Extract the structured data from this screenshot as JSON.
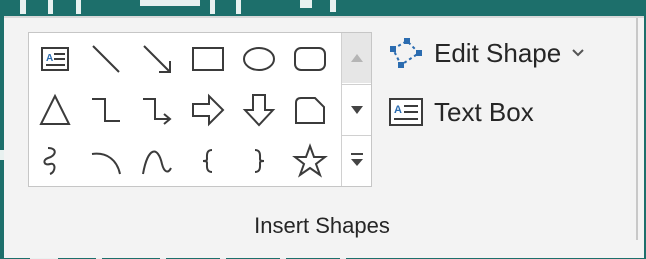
{
  "ribbon": {
    "group_label": "Insert Shapes",
    "commands": [
      {
        "label": "Edit Shape",
        "icon": "edit-shape-icon",
        "has_dropdown": true
      },
      {
        "label": "Text Box",
        "icon": "text-box-icon",
        "has_dropdown": false
      }
    ],
    "gallery": {
      "shapes": [
        [
          "text-box-shape-icon",
          "line-icon",
          "arrow-line-icon",
          "rectangle-icon",
          "oval-icon",
          "rounded-rectangle-icon"
        ],
        [
          "triangle-icon",
          "elbow-connector-icon",
          "elbow-arrow-connector-icon",
          "right-arrow-icon",
          "down-arrow-icon",
          "snip-corner-rectangle-icon"
        ],
        [
          "freeform-scribble-icon",
          "arc-icon",
          "curve-icon",
          "left-brace-icon",
          "right-brace-icon",
          "star-icon"
        ]
      ],
      "scroll": [
        "scroll-up-icon",
        "scroll-down-icon",
        "more-icon"
      ]
    },
    "colors": {
      "background": "#1d6f6b",
      "ribbon": "#f3f3f3",
      "icon_stroke": "#3b3b3b",
      "accent_blue": "#2b6cb0"
    }
  }
}
